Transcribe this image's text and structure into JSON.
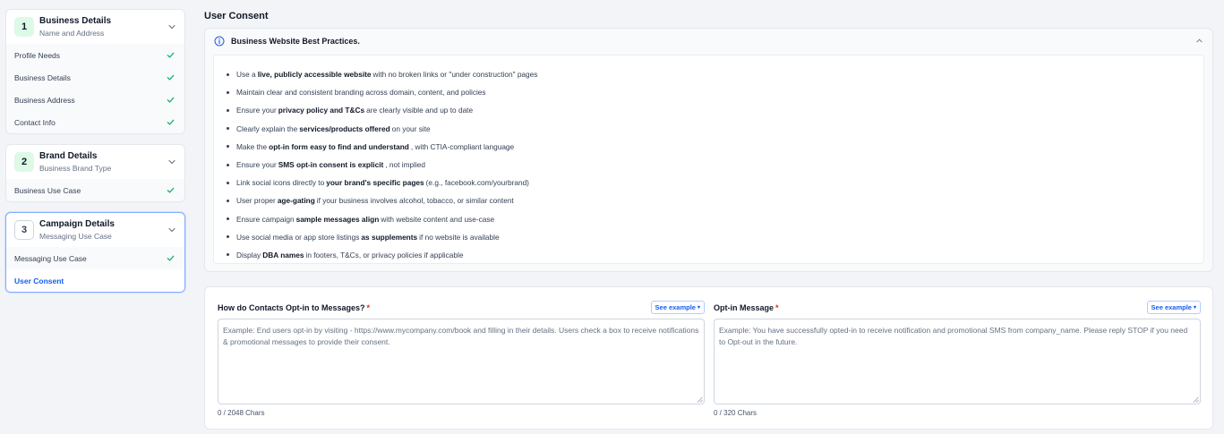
{
  "sidebar": {
    "steps": [
      {
        "number": "1",
        "title": "Business Details",
        "subtitle": "Name and Address",
        "items": [
          {
            "label": "Profile Needs"
          },
          {
            "label": "Business Details"
          },
          {
            "label": "Business Address"
          },
          {
            "label": "Contact Info"
          }
        ]
      },
      {
        "number": "2",
        "title": "Brand Details",
        "subtitle": "Business Brand Type",
        "items": [
          {
            "label": "Business Use Case"
          }
        ]
      },
      {
        "number": "3",
        "title": "Campaign Details",
        "subtitle": "Messaging Use Case",
        "items": [
          {
            "label": "Messaging Use Case"
          },
          {
            "label": "User Consent"
          }
        ]
      }
    ]
  },
  "main": {
    "title": "User Consent",
    "best_practices": {
      "title": "Business Website Best Practices.",
      "items": [
        {
          "pre": "Use a",
          "bold": "live, publicly accessible website",
          "post": "with no broken links or \"under construction\" pages"
        },
        {
          "pre": "Maintain clear and consistent branding across domain, content, and policies",
          "bold": "",
          "post": ""
        },
        {
          "pre": "Ensure your",
          "bold": "privacy policy and T&Cs",
          "post": "are clearly visible and up to date"
        },
        {
          "pre": "Clearly explain the",
          "bold": "services/products offered",
          "post": "on your site"
        },
        {
          "pre": "Make the",
          "bold": "opt-in form easy to find and understand",
          "post": ", with CTIA-compliant language"
        },
        {
          "pre": "Ensure your",
          "bold": "SMS opt-in consent is explicit",
          "post": ", not implied"
        },
        {
          "pre": "Link social icons directly to",
          "bold": "your brand's specific pages",
          "post": "(e.g., facebook.com/yourbrand)"
        },
        {
          "pre": "User proper",
          "bold": "age-gating",
          "post": "if your business involves alcohol, tobacco, or similar content"
        },
        {
          "pre": "Ensure campaign",
          "bold": "sample messages align",
          "post": "with website content and use-case"
        },
        {
          "pre": "Use social media or app store listings",
          "bold": "as supplements",
          "post": "if no website is available"
        },
        {
          "pre": "Display",
          "bold": "DBA names",
          "post": "in footers, T&Cs, or privacy policies if applicable"
        }
      ]
    },
    "form": {
      "optin": {
        "label": "How do Contacts Opt-in to Messages?",
        "required": "*",
        "see_example": "See example",
        "placeholder": "Example: End users opt-in by visiting - https://www.mycompany.com/book and filling in their details. Users check a box to receive notifications & promotional messages to provide their consent.",
        "counter": "0 / 2048 Chars"
      },
      "message": {
        "label": "Opt-in Message",
        "required": "*",
        "see_example": "See example",
        "placeholder": "Example: You have successfully opted-in to receive notification and promotional SMS from company_name. Please reply STOP if you need to Opt-out in the future.",
        "counter": "0 / 320 Chars"
      }
    }
  },
  "icons": {
    "chevron": "chevron-down-icon",
    "check": "check-circle-icon",
    "info": "info-circle-icon"
  },
  "colors": {
    "accent": "#155eef",
    "success": "#17b26a",
    "required": "#d92d20"
  }
}
